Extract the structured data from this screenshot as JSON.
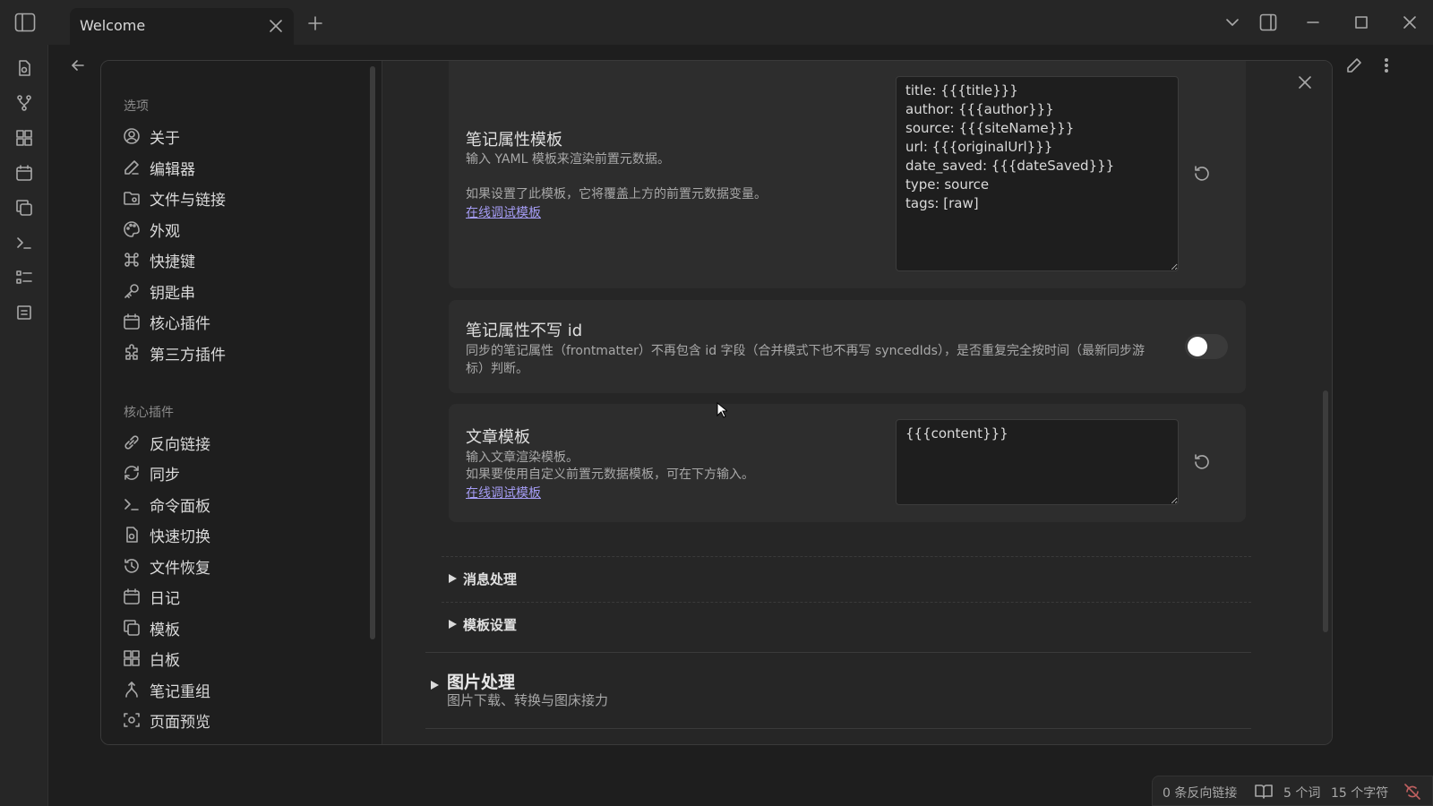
{
  "titlebar": {
    "tab_title": "Welcome"
  },
  "statusbar": {
    "backlinks": "0 条反向链接",
    "words": "5 个词",
    "chars": "15 个字符"
  },
  "nav": {
    "options_heading": "选项",
    "options": [
      {
        "label": "关于",
        "icon": "user-circle-icon"
      },
      {
        "label": "编辑器",
        "icon": "pencil-icon"
      },
      {
        "label": "文件与链接",
        "icon": "folder-icon"
      },
      {
        "label": "外观",
        "icon": "palette-icon"
      },
      {
        "label": "快捷键",
        "icon": "command-icon"
      },
      {
        "label": "钥匙串",
        "icon": "key-icon"
      },
      {
        "label": "核心插件",
        "icon": "calendar-icon"
      },
      {
        "label": "第三方插件",
        "icon": "puzzle-icon"
      }
    ],
    "core_heading": "核心插件",
    "core": [
      {
        "label": "反向链接",
        "icon": "link-icon"
      },
      {
        "label": "同步",
        "icon": "sync-icon"
      },
      {
        "label": "命令面板",
        "icon": "terminal-icon"
      },
      {
        "label": "快速切换",
        "icon": "file-search-icon"
      },
      {
        "label": "文件恢复",
        "icon": "history-icon"
      },
      {
        "label": "日记",
        "icon": "calendar-icon"
      },
      {
        "label": "模板",
        "icon": "copy-icon"
      },
      {
        "label": "白板",
        "icon": "grid-icon"
      },
      {
        "label": "笔记重组",
        "icon": "merge-icon"
      },
      {
        "label": "页面预览",
        "icon": "preview-icon"
      }
    ]
  },
  "settings": {
    "frontmatter_template": {
      "title": "笔记属性模板",
      "desc1": "输入 YAML 模板来渲染前置元数据。",
      "desc2": "如果设置了此模板，它将覆盖上方的前置元数据变量。",
      "link": "在线调试模板",
      "value": "title: {{{title}}}\nauthor: {{{author}}}\nsource: {{{siteName}}}\nurl: {{{originalUrl}}}\ndate_saved: {{{dateSaved}}}\ntype: source\ntags: [raw]"
    },
    "no_id": {
      "title": "笔记属性不写 id",
      "desc": "同步的笔记属性（frontmatter）不再包含 id 字段（合并模式下也不再写 syncedIds），是否重复完全按时间（最新同步游标）判断。",
      "enabled": false
    },
    "article_template": {
      "title": "文章模板",
      "desc1": "输入文章渲染模板。",
      "desc2": "如果要使用自定义前置元数据模板，可在下方输入。",
      "link": "在线调试模板",
      "value": "{{{content}}}"
    },
    "message_section": "消息处理",
    "template_section": "模板设置",
    "image_section": {
      "title": "图片处理",
      "desc": "图片下载、转换与图床接力"
    }
  },
  "colors": {
    "accent": "#a59cf4",
    "background": "#1e1e1e",
    "card": "#2d2d2d"
  }
}
